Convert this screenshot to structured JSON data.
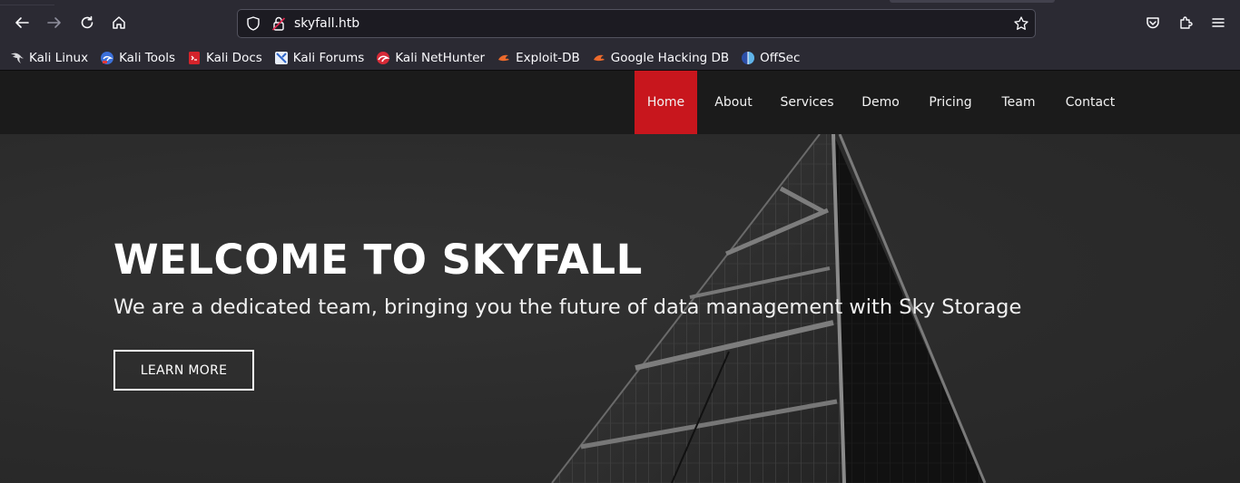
{
  "browser": {
    "url": "skyfall.htb",
    "bookmarks": [
      {
        "label": "Kali Linux",
        "icon": "kali-dragon-icon"
      },
      {
        "label": "Kali Tools",
        "icon": "kali-tools-icon"
      },
      {
        "label": "Kali Docs",
        "icon": "kali-docs-icon"
      },
      {
        "label": "Kali Forums",
        "icon": "kali-forums-icon"
      },
      {
        "label": "Kali NetHunter",
        "icon": "kali-nethunter-icon"
      },
      {
        "label": "Exploit-DB",
        "icon": "exploit-db-icon"
      },
      {
        "label": "Google Hacking DB",
        "icon": "google-hacking-db-icon"
      },
      {
        "label": "OffSec",
        "icon": "offsec-icon"
      }
    ]
  },
  "site": {
    "nav": [
      "Home",
      "About",
      "Services",
      "Demo",
      "Pricing",
      "Team",
      "Contact"
    ],
    "active_nav": "Home",
    "hero": {
      "title": "WELCOME TO SKYFALL",
      "subtitle": "We are a dedicated team, bringing you the future of data management with Sky Storage",
      "button": "LEARN MORE"
    }
  },
  "colors": {
    "accent": "#c8161d",
    "chrome": "#2b2a33",
    "nav_bg": "#1b1b1b"
  }
}
